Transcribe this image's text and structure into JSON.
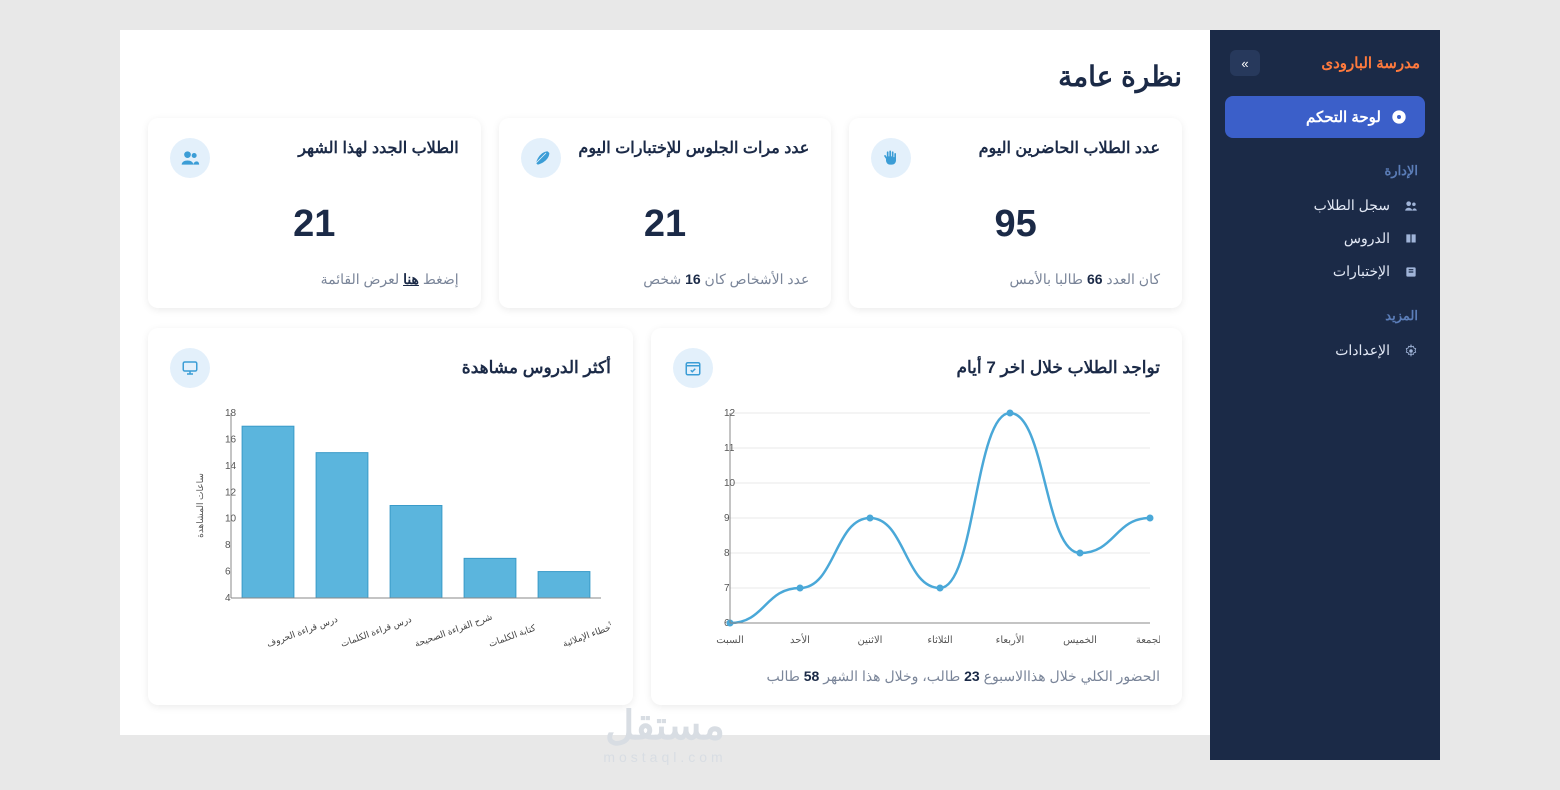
{
  "sidebar": {
    "school_name": "مدرسة البارودى",
    "dashboard_label": "لوحة التحكم",
    "section_admin": "الإدارة",
    "section_more": "المزيد",
    "items": [
      {
        "label": "سجل الطلاب",
        "icon": "users"
      },
      {
        "label": "الدروس",
        "icon": "book"
      },
      {
        "label": "الإختبارات",
        "icon": "test"
      }
    ],
    "more_items": [
      {
        "label": "الإعدادات",
        "icon": "gear"
      }
    ]
  },
  "page": {
    "title": "نظرة عامة"
  },
  "cards": [
    {
      "title": "عدد الطلاب الحاضرين اليوم",
      "value": "95",
      "foot_pre": "كان العدد ",
      "foot_bold": "66",
      "foot_post": " طالبا بالأمس",
      "icon": "hand"
    },
    {
      "title": "عدد مرات الجلوس للإختبارات اليوم",
      "value": "21",
      "foot_pre": "عدد الأشخاص كان ",
      "foot_bold": "16",
      "foot_post": " شخص",
      "icon": "feather"
    },
    {
      "title": "الطلاب الجدد لهذا الشهر",
      "value": "21",
      "foot_pre": "إضغط ",
      "foot_link": "هنا",
      "foot_post": " لعرض القائمة",
      "icon": "users"
    }
  ],
  "charts": {
    "line": {
      "title": "تواجد الطلاب خلال اخر 7 أيام",
      "foot_parts": [
        "الحضور الكلي خلال هذاالاسبوع ",
        "23",
        " طالب، وخلال هذا الشهر ",
        "58",
        " طالب"
      ],
      "icon": "calendar"
    },
    "bar": {
      "title": "أكثر الدروس مشاهدة",
      "icon": "monitor"
    }
  },
  "chart_data": [
    {
      "type": "line",
      "categories": [
        "السبت",
        "الأحد",
        "الاثنين",
        "الثلاثاء",
        "الأربعاء",
        "الخميس",
        "الجمعة"
      ],
      "values": [
        6,
        7,
        9,
        7,
        12,
        8,
        9
      ],
      "title": "تواجد الطلاب خلال اخر 7 أيام",
      "xlabel": "",
      "ylabel": "",
      "ylim": [
        6,
        12
      ]
    },
    {
      "type": "bar",
      "categories": [
        "درس قراءة الحروف",
        "درس قراءة الكلمات",
        "شرح القراءة الصحيحة",
        "كتابة الكلمات",
        "درس الأخطاء الإملائية"
      ],
      "values": [
        17,
        15,
        11,
        7,
        6
      ],
      "title": "أكثر الدروس مشاهدة",
      "xlabel": "",
      "ylabel": "ساعات المشاهدة",
      "ylim": [
        4,
        18
      ]
    }
  ],
  "watermark": {
    "big": "مستقل",
    "small": "mostaql.com"
  }
}
